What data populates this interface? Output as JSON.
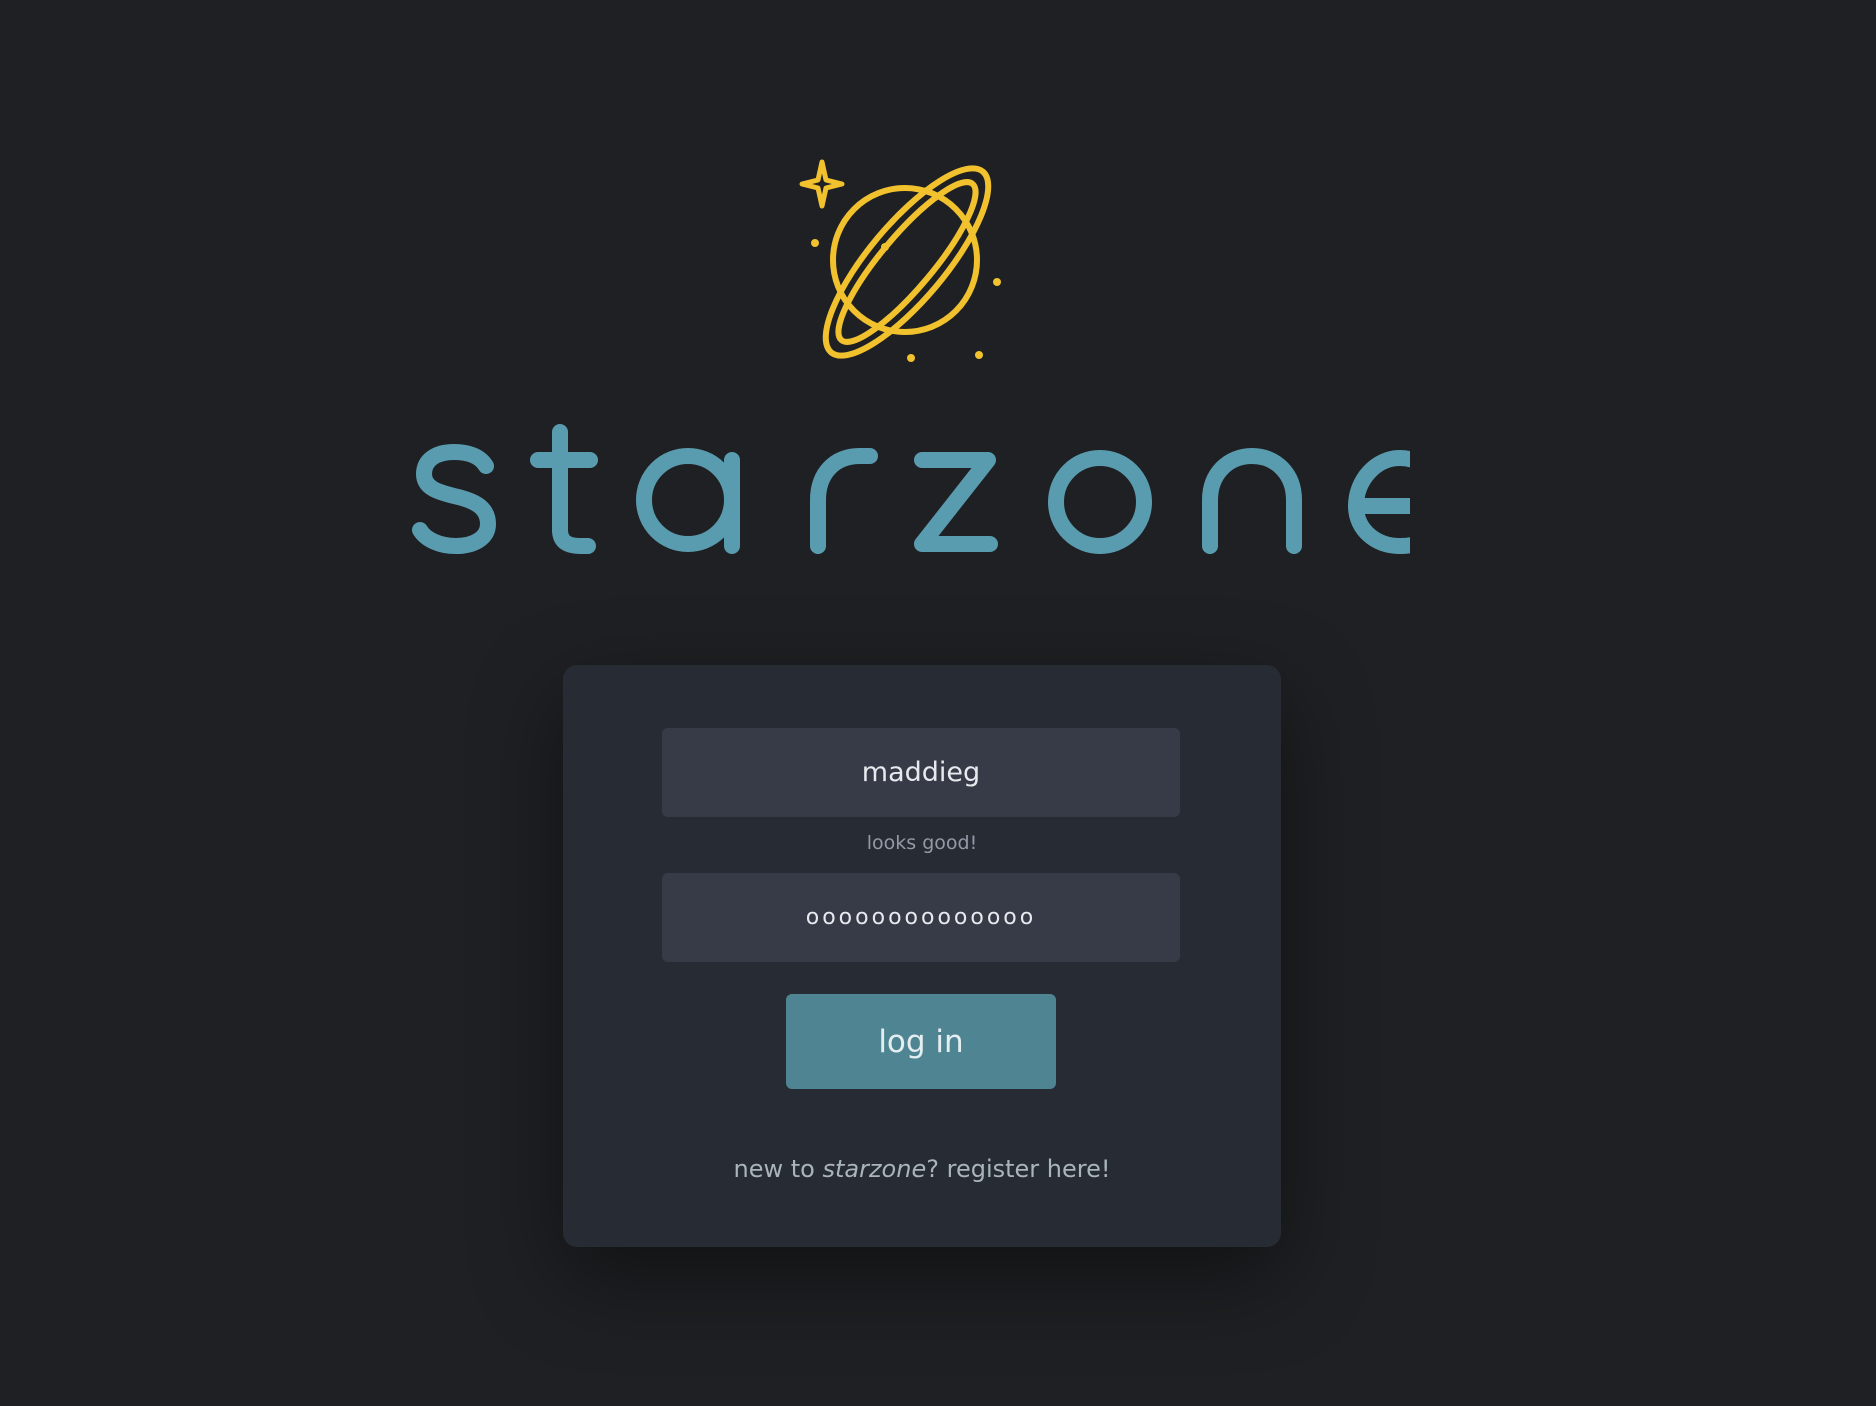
{
  "brand": {
    "name": "starzone",
    "logo_color": "#f1c22e",
    "wordmark_color": "#5a9caf"
  },
  "login_form": {
    "username_value": "maddieg",
    "username_hint": "looks good!",
    "password_value": "oooooooooooooo",
    "submit_label": "log in",
    "register_prefix": "new to ",
    "register_brand": "starzone",
    "register_suffix": "?",
    "register_link_label": "register here!"
  },
  "colors": {
    "background": "#1f2023",
    "card": "#272b33",
    "input": "#373b47",
    "button": "#4f8593"
  }
}
